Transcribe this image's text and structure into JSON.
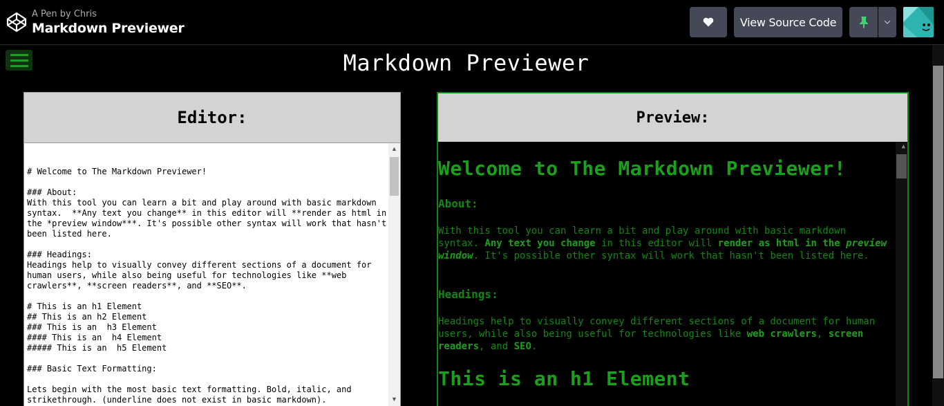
{
  "header": {
    "byline": "A Pen by Chris",
    "title": "Markdown Previewer",
    "view_source_label": "View Source Code",
    "icons": [
      "codepen-logo-icon",
      "heart-icon",
      "pin-icon",
      "chevron-down-icon",
      "avatar"
    ]
  },
  "app": {
    "title": "Markdown Previewer",
    "editor_label": "Editor:",
    "preview_label": "Preview:",
    "editor_text": "# Welcome to The Markdown Previewer!\n\n### About:\nWith this tool you can learn a bit and play around with basic markdown\nsyntax.  **Any text you change** in this editor will **render as html in\nthe *preview window***. It's possible other syntax will work that hasn't\nbeen listed here.\n\n### Headings:\nHeadings help to visually convey different sections of a document for\nhuman users, while also being useful for technologies like **web\ncrawlers**, **screen readers**, and **SEO**.\n\n# This is an h1 Element\n## This is an h2 Element\n### This is an  h3 Element\n#### This is an  h4 Element\n##### This is an  h5 Element\n\n### Basic Text Formatting:\n\nLets begin with the most basic text formatting. Bold, italic, and\nstrikethrough. (underline does not exist in basic markdown).",
    "preview": {
      "h1": "Welcome to The Markdown Previewer!",
      "about_heading": "About:",
      "about_p1": "With this tool you can learn a bit and play around with basic markdown syntax.",
      "about_b1": "Any text you change",
      "about_p2": "in this editor will",
      "about_b2": "render as html in the",
      "about_bi": "preview window",
      "about_p3": ". It's possible other syntax will work that hasn't been listed here.",
      "headings_heading": "Headings:",
      "headings_p1": "Headings help to visually convey different sections of a document for human users, while also being useful for technologies like",
      "headings_b1": "web crawlers",
      "headings_b2": "screen readers",
      "headings_p2": ", and",
      "headings_b3": "SEO",
      "headings_p3": ".",
      "h1_element": "This is an h1 Element"
    }
  },
  "colors": {
    "accent_green": "#1aa01a",
    "codepen_button": "#444857"
  }
}
